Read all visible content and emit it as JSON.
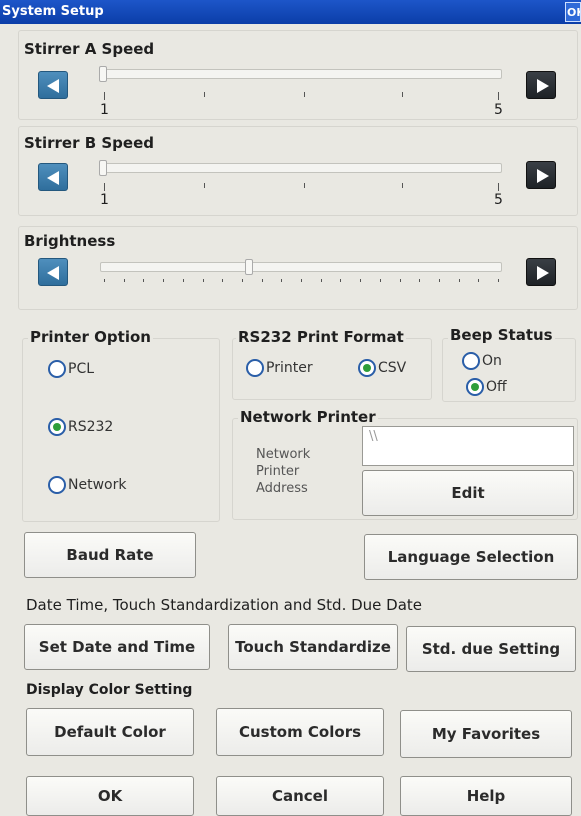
{
  "window": {
    "title": "System Setup",
    "ok_label": "OK"
  },
  "stirrer_a": {
    "label": "Stirrer A Speed",
    "min_label": "1",
    "max_label": "5",
    "min": 1,
    "max": 5,
    "value": 1
  },
  "stirrer_b": {
    "label": "Stirrer B Speed",
    "min_label": "1",
    "max_label": "5",
    "min": 1,
    "max": 5,
    "value": 1
  },
  "brightness": {
    "label": "Brightness",
    "value_fraction": 0.37
  },
  "printer_option": {
    "label": "Printer Option",
    "pcl": "PCL",
    "rs232": "RS232",
    "network": "Network",
    "selected": "RS232"
  },
  "rs232_format": {
    "label": "RS232 Print Format",
    "printer": "Printer",
    "csv": "CSV",
    "selected": "CSV"
  },
  "beep_status": {
    "label": "Beep Status",
    "on": "On",
    "off": "Off",
    "selected": "Off"
  },
  "network_printer": {
    "label": "Network Printer",
    "address_label_1": "Network",
    "address_label_2": "Printer",
    "address_label_3": "Address",
    "address_value": "\\\\",
    "edit_label": "Edit"
  },
  "buttons": {
    "baud_rate": "Baud Rate",
    "language_selection": "Language Selection",
    "set_date_time": "Set Date and Time",
    "touch_standardize": "Touch Standardize",
    "std_due_setting": "Std. due Setting",
    "default_color": "Default Color",
    "custom_colors": "Custom Colors",
    "my_favorites": "My Favorites",
    "ok": "OK",
    "cancel": "Cancel",
    "help": "Help"
  },
  "date_section": {
    "label": "Date Time, Touch Standardization and Std. Due Date"
  },
  "display_color": {
    "label": "Display Color Setting"
  }
}
